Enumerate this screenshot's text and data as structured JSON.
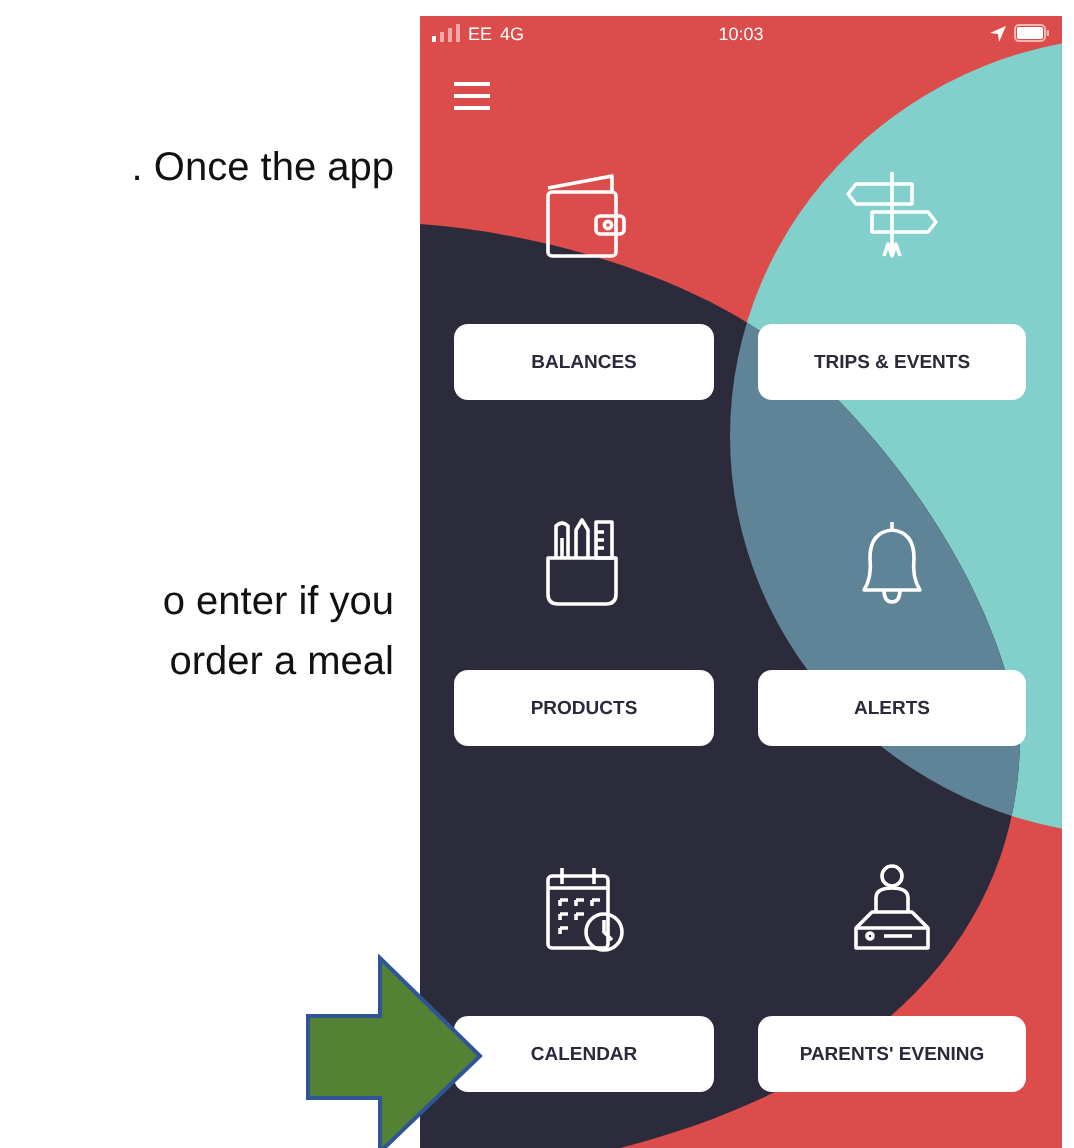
{
  "document_text": [
    ". Once the app",
    "o enter if you",
    "order a meal"
  ],
  "phone": {
    "status_bar": {
      "carrier": "EE",
      "network": "4G",
      "time": "10:03"
    },
    "tiles": [
      {
        "label": "BALANCES",
        "kind": "wallet"
      },
      {
        "label": "TRIPS & EVENTS",
        "kind": "signpost"
      },
      {
        "label": "PRODUCTS",
        "kind": "pot"
      },
      {
        "label": "ALERTS",
        "kind": "bell"
      },
      {
        "label": "CALENDAR",
        "kind": "calendar"
      },
      {
        "label": "PARENTS' EVENING",
        "kind": "desk"
      }
    ]
  }
}
